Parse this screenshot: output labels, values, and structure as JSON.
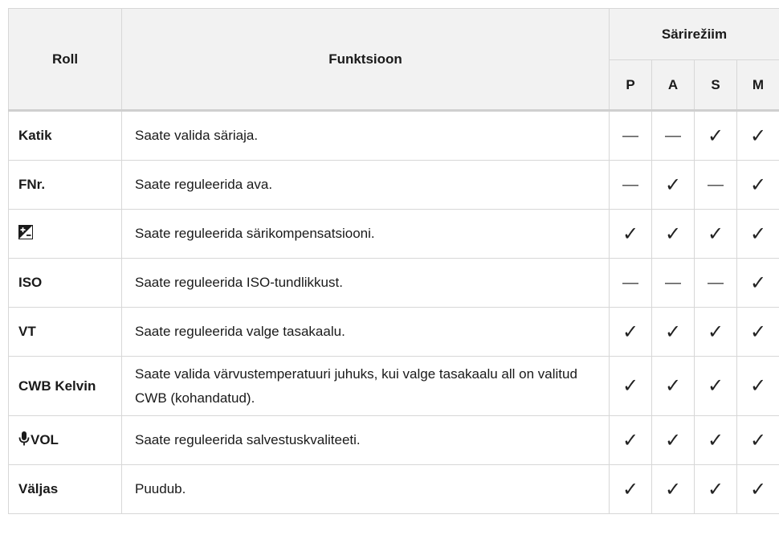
{
  "header": {
    "role_label": "Roll",
    "function_label": "Funktsioon",
    "mode_group_label": "Särirežiim",
    "modes": [
      "P",
      "A",
      "S",
      "M"
    ]
  },
  "symbols": {
    "supported": "✓",
    "unsupported": "—"
  },
  "rows": [
    {
      "role": "Katik",
      "role_icon": "",
      "function": "Saate valida säriaja.",
      "modes": [
        "—",
        "—",
        "✓",
        "✓"
      ]
    },
    {
      "role": "FNr.",
      "role_icon": "",
      "function": "Saate reguleerida ava.",
      "modes": [
        "—",
        "✓",
        "—",
        "✓"
      ]
    },
    {
      "role": "",
      "role_icon": "exposure-compensation-icon",
      "function": "Saate reguleerida särikompensatsiooni.",
      "modes": [
        "✓",
        "✓",
        "✓",
        "✓"
      ]
    },
    {
      "role": "ISO",
      "role_icon": "",
      "function": "Saate reguleerida ISO-tundlikkust.",
      "modes": [
        "—",
        "—",
        "—",
        "✓"
      ]
    },
    {
      "role": "VT",
      "role_icon": "",
      "function": "Saate reguleerida valge tasakaalu.",
      "modes": [
        "✓",
        "✓",
        "✓",
        "✓"
      ]
    },
    {
      "role": "CWB Kelvin",
      "role_icon": "",
      "function": "Saate valida värvustemperatuuri juhuks, kui valge tasakaalu all on valitud CWB (kohandatud).",
      "modes": [
        "✓",
        "✓",
        "✓",
        "✓"
      ]
    },
    {
      "role": "VOL",
      "role_icon": "microphone-icon",
      "function": "Saate reguleerida salvestuskvaliteeti.",
      "modes": [
        "✓",
        "✓",
        "✓",
        "✓"
      ]
    },
    {
      "role": "Väljas",
      "role_icon": "",
      "function": "Puudub.",
      "modes": [
        "✓",
        "✓",
        "✓",
        "✓"
      ]
    }
  ]
}
